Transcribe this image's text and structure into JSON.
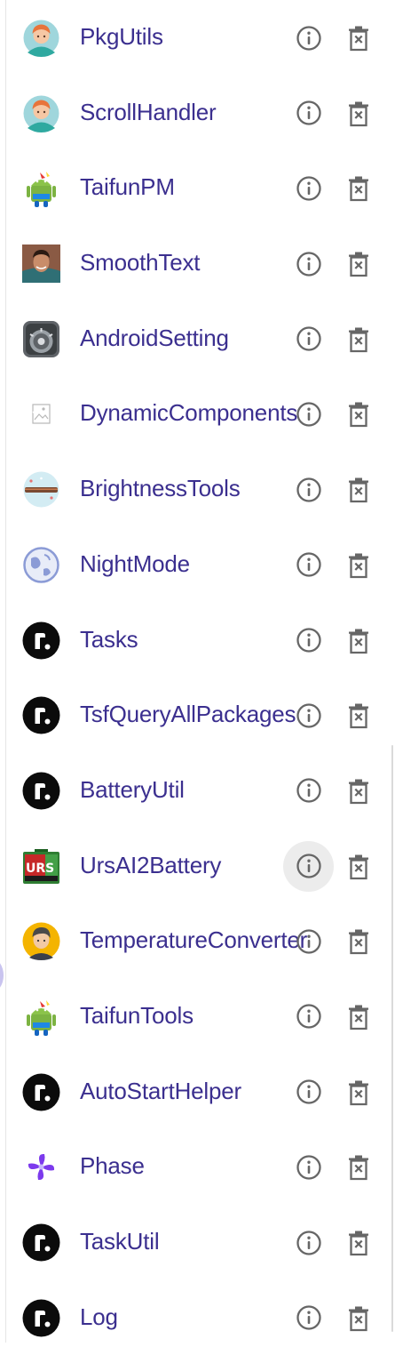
{
  "extensions": [
    {
      "name": "PkgUtils",
      "icon": "avatar-redhead-icon",
      "selected": false
    },
    {
      "name": "ScrollHandler",
      "icon": "avatar-redhead-icon",
      "selected": false
    },
    {
      "name": "TaifunPM",
      "icon": "taifun-android-icon",
      "selected": false
    },
    {
      "name": "SmoothText",
      "icon": "person-photo-icon",
      "selected": false
    },
    {
      "name": "AndroidSetting",
      "icon": "settings-gear-icon",
      "selected": false
    },
    {
      "name": "DynamicComponents",
      "icon": "broken-image-icon",
      "selected": false
    },
    {
      "name": "BrightnessTools",
      "icon": "brightness-slider-icon",
      "selected": false
    },
    {
      "name": "NightMode",
      "icon": "globe-icon",
      "selected": false
    },
    {
      "name": "Tasks",
      "icon": "r-logo-icon",
      "selected": false
    },
    {
      "name": "TsfQueryAllPackages",
      "icon": "r-logo-icon",
      "selected": false
    },
    {
      "name": "BatteryUtil",
      "icon": "r-logo-icon",
      "selected": false
    },
    {
      "name": "UrsAI2Battery",
      "icon": "urs-battery-icon",
      "selected": true
    },
    {
      "name": "TemperatureConverter",
      "icon": "avatar-cartoon-icon",
      "selected": false
    },
    {
      "name": "TaifunTools",
      "icon": "taifun-android-icon",
      "selected": false
    },
    {
      "name": "AutoStartHelper",
      "icon": "r-logo-icon",
      "selected": false
    },
    {
      "name": "Phase",
      "icon": "pinwheel-icon",
      "selected": false
    },
    {
      "name": "TaskUtil",
      "icon": "r-logo-icon",
      "selected": false
    },
    {
      "name": "Log",
      "icon": "r-logo-icon",
      "selected": false
    }
  ],
  "actions": {
    "info_icon": "info-circle-icon",
    "delete_icon": "trash-icon"
  },
  "colors": {
    "name_text": "#3b2f8f",
    "action_icon": "#666666",
    "hover_circle": "#ececec"
  }
}
